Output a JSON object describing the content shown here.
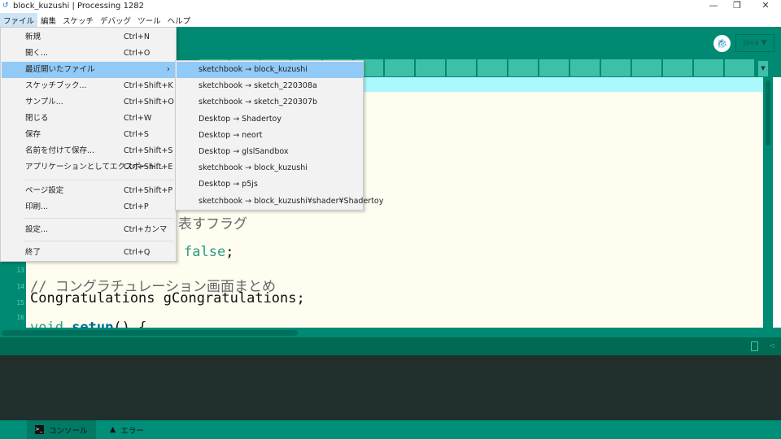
{
  "window": {
    "title": "block_kuzushi | Processing 1282",
    "minimize": "—",
    "restore": "❐",
    "close": "✕"
  },
  "menubar": [
    "ファイル",
    "編集",
    "スケッチ",
    "デバッグ",
    "ツール",
    "ヘルプ"
  ],
  "toolbar": {
    "mode": "Java ▼",
    "debug_icon": "bug"
  },
  "tabs": {
    "overflow": "▼"
  },
  "file_menu": [
    {
      "label": "新規",
      "shortcut": "Ctrl+N"
    },
    {
      "label": "開く...",
      "shortcut": "Ctrl+O"
    },
    {
      "label": "最近開いたファイル",
      "shortcut": "›"
    },
    {
      "label": "スケッチブック...",
      "shortcut": "Ctrl+Shift+K"
    },
    {
      "label": "サンプル...",
      "shortcut": "Ctrl+Shift+O"
    },
    {
      "label": "閉じる",
      "shortcut": "Ctrl+W"
    },
    {
      "label": "保存",
      "shortcut": "Ctrl+S"
    },
    {
      "label": "名前を付けて保存...",
      "shortcut": "Ctrl+Shift+S"
    },
    {
      "label": "アプリケーションとしてエクスポート...",
      "shortcut": "Ctrl+Shift+E"
    },
    {
      "label": "ページ設定",
      "shortcut": "Ctrl+Shift+P"
    },
    {
      "label": "印刷...",
      "shortcut": "Ctrl+P"
    },
    {
      "label": "設定...",
      "shortcut": "Ctrl+カンマ"
    },
    {
      "label": "終了",
      "shortcut": "Ctrl+Q"
    }
  ],
  "recent_files": [
    "sketchbook → block_kuzushi",
    "sketchbook → sketch_220308a",
    "sketchbook → sketch_220307b",
    "Desktop → Shadertoy",
    "Desktop → neort",
    "Desktop → glslSandbox",
    "sketchbook → block_kuzushi",
    "Desktop → p5js",
    "sketchbook → block_kuzushi¥shader¥Shadertoy"
  ],
  "editor": {
    "line_numbers": [
      "13",
      "14",
      "15",
      "16"
    ],
    "frag1": "を表すフラグ",
    "frag2": "false",
    "frag2b": ";",
    "comment": "// コングラチュレーション画面まとめ",
    "line15": "Congratulations gCongratulations;",
    "line17a": "void ",
    "line17b": "setup",
    "line17c": "() {"
  },
  "bottom_tabs": {
    "console": "コンソール",
    "errors": "エラー"
  }
}
